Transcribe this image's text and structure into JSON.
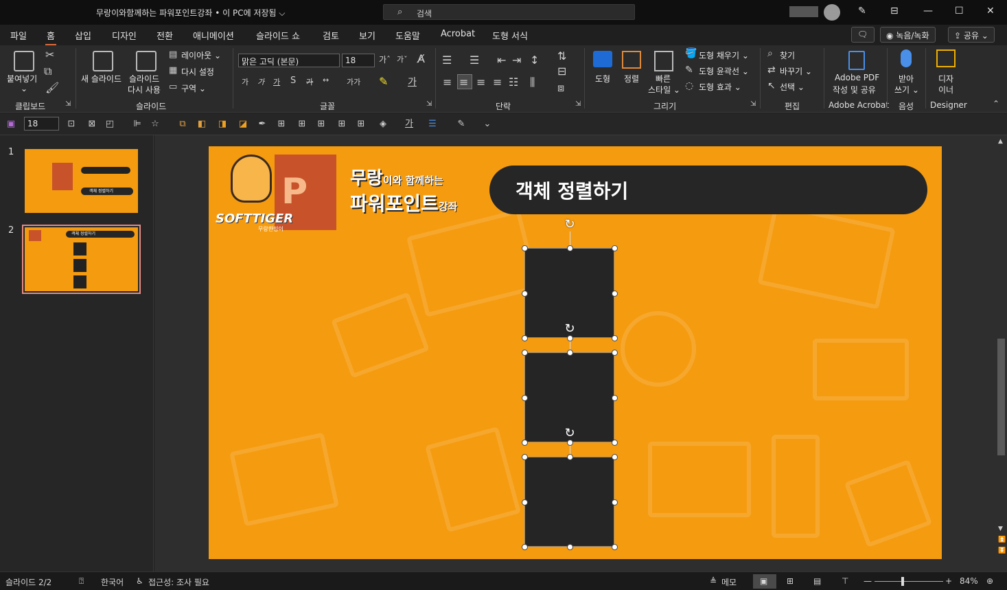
{
  "window": {
    "title": "무랑이와함께하는 파워포인트강좌 • 이 PC에 저장됨 ⌵",
    "search_placeholder": "검색"
  },
  "menu": {
    "tabs": [
      "파일",
      "홈",
      "삽입",
      "디자인",
      "전환",
      "애니메이션",
      "슬라이드 쇼",
      "검토",
      "보기",
      "도움말",
      "Acrobat",
      "도형 서식"
    ],
    "active_tab": "홈",
    "record_label": "◉ 녹음/녹화",
    "share_label": "⇪ 공유 ⌄"
  },
  "ribbon": {
    "groups": {
      "clipboard": "클립보드",
      "slides": "슬라이드",
      "font": "글꼴",
      "paragraph": "단락",
      "drawing": "그리기",
      "editing": "편집",
      "acrobat": "Adobe Acrobat",
      "voice": "음성",
      "designer": "Designer"
    },
    "paste": "붙여넣기",
    "new_slide_1": "새 슬라이드",
    "reuse_1": "슬라이드",
    "reuse_2": "다시 사용",
    "layout": "레이아웃 ⌄",
    "reset": "다시 설정",
    "section": "구역 ⌄",
    "font_name": "맑은 고딕 (본문)",
    "font_size": "18",
    "shape": "도형",
    "arrange": "정렬",
    "quick_style_1": "빠른",
    "quick_style_2": "스타일 ⌄",
    "shape_fill": "도형 채우기 ⌄",
    "shape_outline": "도형 윤곽선 ⌄",
    "shape_effects": "도형 효과 ⌄",
    "find": "찾기",
    "replace": "바꾸기 ⌄",
    "select": "선택 ⌄",
    "adobe_1": "Adobe PDF",
    "adobe_2": "작성 및 공유",
    "dictate_1": "받아",
    "dictate_2": "쓰기 ⌄",
    "designer_1": "디자",
    "designer_2": "이너"
  },
  "qat": {
    "font_size": "18"
  },
  "thumbnails": [
    {
      "number": "1",
      "title": "객체 정렬하기"
    },
    {
      "number": "2",
      "title": "객체 정렬하기"
    }
  ],
  "slide": {
    "title": "객체 정렬하기",
    "brand_line1": "무랑",
    "brand_line1b": "이와 함께하는",
    "brand_line2": "파워포인트",
    "brand_line2b": "강좌",
    "logo_text": "SOFTTIGER",
    "logo_sub": "무랑한밍이"
  },
  "status": {
    "slide_info": "슬라이드 2/2",
    "language": "한국어",
    "accessibility": "접근성: 조사 필요",
    "notes": "메모",
    "zoom": "84%"
  },
  "colors": {
    "accent": "#e06a3b",
    "slide_bg": "#f59b10",
    "pill_bg": "#262626"
  }
}
